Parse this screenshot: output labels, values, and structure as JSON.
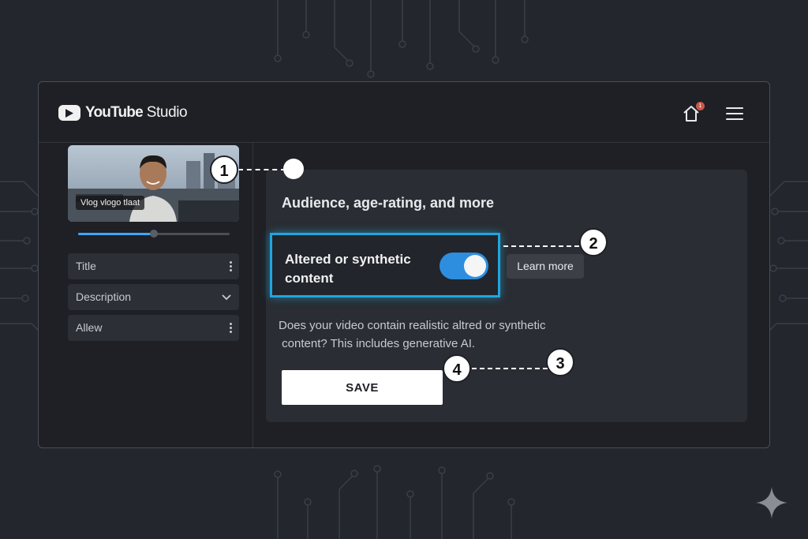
{
  "app": {
    "brand_main": "YouTube",
    "brand_sub": "Studio"
  },
  "header": {
    "notification_count": "1"
  },
  "sidebar": {
    "thumbnail_caption": "Vlog vlogo tlaat",
    "progress_fraction": 0.5,
    "fields": [
      {
        "label": "Title"
      },
      {
        "label": "Description"
      },
      {
        "label": "Allew"
      }
    ]
  },
  "panel": {
    "title": "Audience, age-rating, and more",
    "toggle_label_line1": "Altered or synthetic",
    "toggle_label_line2": "content",
    "toggle_on": true,
    "learn_more": "Learn more",
    "description_line1": "Does your video contain realistic altred or synthetic",
    "description_line2": "content? This includes generative AI.",
    "save_label": "SAVE"
  },
  "markers": [
    "1",
    "2",
    "3",
    "4"
  ],
  "colors": {
    "accent": "#1fa6e0",
    "toggle": "#2d8ee0",
    "background": "#23262c",
    "notification": "#c9574a"
  }
}
